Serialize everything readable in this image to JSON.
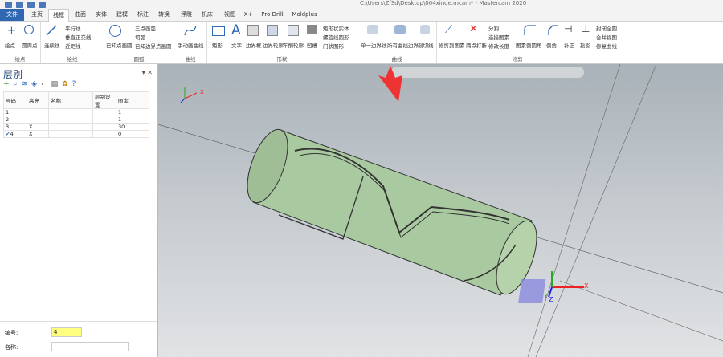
{
  "window": {
    "title": "C:\\Users\\ZfSd\\Desktop\\004xinde.mcam* - Mastercam 2020"
  },
  "tabs": [
    "文件",
    "主页",
    "线框",
    "曲面",
    "实体",
    "建模",
    "标注",
    "转换",
    "浮雕",
    "机床",
    "视图",
    "X+",
    "Pro Drill",
    "Moldplus"
  ],
  "active_tab": "线框",
  "ribbon": {
    "groups": {
      "points": "绘点",
      "lines": "绘线",
      "arcs": "圆弧",
      "curves": "曲线",
      "shapes": "形状",
      "edges": "曲线",
      "trim": "修剪"
    },
    "buttons": {
      "point": "绘点",
      "circle_point": "圆周点",
      "line_endpoints": "连续线",
      "parallel": "平行线",
      "perp_normal": "垂直正交线",
      "closest_line": "近距线",
      "circle_center": "已知点画圆",
      "three_point_arc": "三点画弧",
      "tangent_arc": "切弧",
      "arc_endpoints": "已知边界点画圆",
      "manual_curve": "手动画曲线",
      "rectangle": "矩形",
      "text": "文字",
      "bounding_box": "边界框",
      "boundary_contour": "边界轮廓",
      "turn_profile": "车削轮廓",
      "recess": "凹槽",
      "rect_shape": "矩形状实体",
      "spiral": "螺旋线圆形",
      "door_shape": "门状图形",
      "single_edge": "单一边界线",
      "all_edges": "所有曲线边界",
      "cut_line": "剖切线",
      "trim_to_entity": "修剪到图素",
      "split": "分割",
      "divide": "两点打断",
      "join": "连接图素",
      "modify_length": "修改长度",
      "fillet": "图素倒圆角",
      "chamfer": "倒角",
      "offset": "补正",
      "project": "投影",
      "close_all": "封闭全圆",
      "join_arcs": "合并视图",
      "break_curve": "修复曲线"
    }
  },
  "levels_panel": {
    "title": "层别",
    "columns": [
      "号码",
      "高亮",
      "名称",
      "层别设置",
      "图素"
    ],
    "rows": [
      {
        "num": "1",
        "hl": "",
        "name": "",
        "set": "",
        "count": "1",
        "active": false
      },
      {
        "num": "2",
        "hl": "",
        "name": "",
        "set": "",
        "count": "1",
        "active": false
      },
      {
        "num": "3",
        "hl": "X",
        "name": "",
        "set": "",
        "count": "30",
        "active": false
      },
      {
        "num": "4",
        "hl": "X",
        "name": "",
        "set": "",
        "count": "0",
        "active": true
      }
    ],
    "number_label": "编号:",
    "number_value": "4",
    "name_label": "名称:"
  },
  "viewport": {
    "axis_x": "X",
    "axis_y": "Y",
    "axis_z": "Z"
  },
  "colors": {
    "accent": "#2f67b2",
    "cylinder": "#a9c9a0",
    "annotation": "#e33"
  }
}
